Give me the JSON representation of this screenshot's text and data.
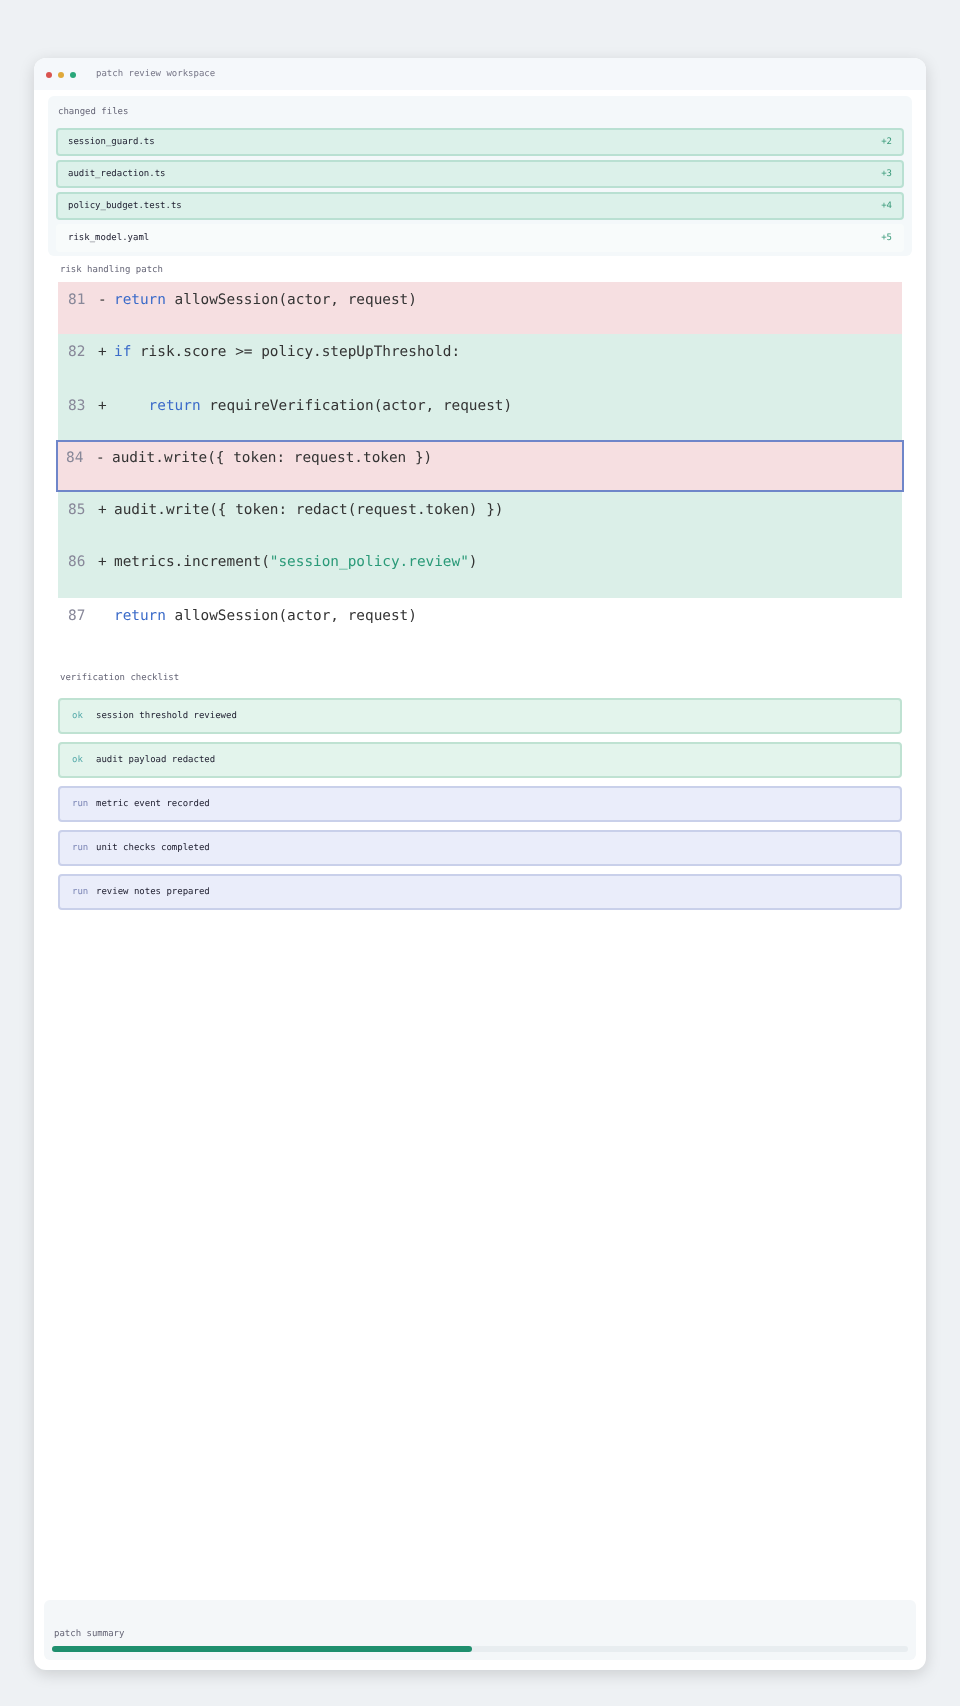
{
  "window": {
    "title": "patch review workspace"
  },
  "changed_files": {
    "title": "changed files",
    "files": [
      {
        "name": "session_guard.ts",
        "count": "+2",
        "kind": "modified"
      },
      {
        "name": "audit_redaction.ts",
        "count": "+3",
        "kind": "modified"
      },
      {
        "name": "policy_budget.test.ts",
        "count": "+4",
        "kind": "modified"
      },
      {
        "name": "risk_model.yaml",
        "count": "+5",
        "kind": "plain"
      }
    ]
  },
  "patch": {
    "title": "risk handling patch",
    "lines": [
      {
        "number": "81",
        "sign": "-",
        "kind": "removed",
        "selected": false,
        "parts": [
          {
            "text": "return",
            "kind": "keyword"
          },
          {
            "text": " allowSession(actor, request)",
            "kind": "plain"
          }
        ]
      },
      {
        "number": "82",
        "sign": "+",
        "kind": "added",
        "selected": false,
        "parts": [
          {
            "text": "if",
            "kind": "keyword"
          },
          {
            "text": " risk.score >= policy.stepUpThreshold:",
            "kind": "plain"
          }
        ]
      },
      {
        "number": "83",
        "sign": "+",
        "kind": "added",
        "selected": false,
        "parts": [
          {
            "text": "    return",
            "kind": "keyword"
          },
          {
            "text": " requireVerification(actor, request)",
            "kind": "plain"
          }
        ]
      },
      {
        "number": "84",
        "sign": "-",
        "kind": "removed",
        "selected": true,
        "parts": [
          {
            "text": "audit.write({ token: request.token })",
            "kind": "plain"
          }
        ]
      },
      {
        "number": "85",
        "sign": "+",
        "kind": "added",
        "selected": false,
        "parts": [
          {
            "text": "audit.write({ token: redact(request.token) })",
            "kind": "plain"
          }
        ]
      },
      {
        "number": "86",
        "sign": "+",
        "kind": "added",
        "selected": false,
        "parts": [
          {
            "text": "metrics.increment(",
            "kind": "plain"
          },
          {
            "text": "\"session_policy.review\"",
            "kind": "string"
          },
          {
            "text": ")",
            "kind": "plain"
          }
        ]
      },
      {
        "number": "87",
        "kind": "context",
        "selected": false,
        "parts": [
          {
            "text": "return",
            "kind": "keyword"
          },
          {
            "text": " allowSession(actor, request)",
            "kind": "plain"
          }
        ]
      }
    ]
  },
  "checklist": {
    "title": "verification checklist",
    "items": [
      {
        "status": "ok",
        "label": "session threshold reviewed",
        "kind": "done"
      },
      {
        "status": "ok",
        "label": "audit payload redacted",
        "kind": "done"
      },
      {
        "status": "run",
        "label": "metric event recorded",
        "kind": "running"
      },
      {
        "status": "run",
        "label": "unit checks completed",
        "kind": "running"
      },
      {
        "status": "run",
        "label": "review notes prepared",
        "kind": "running"
      }
    ]
  },
  "summary": {
    "title": "patch summary",
    "level": 0.49
  }
}
